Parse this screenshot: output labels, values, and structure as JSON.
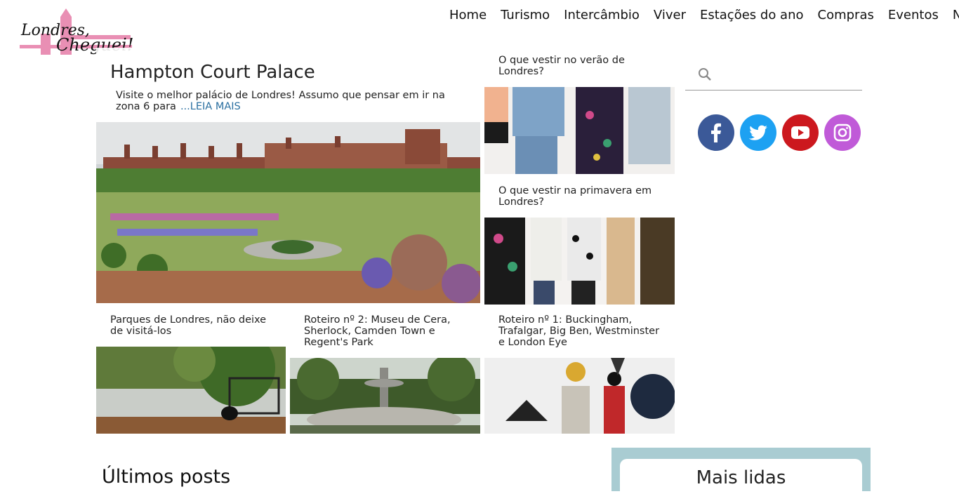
{
  "brand": {
    "logo_line1": "Londres,",
    "logo_line2": "Cheguei!"
  },
  "nav": [
    "Home",
    "Turismo",
    "Intercâmbio",
    "Viver",
    "Estações do ano",
    "Compras",
    "Eventos",
    "News"
  ],
  "hero": {
    "title": "Hampton Court Palace",
    "excerpt": "Visite o melhor palácio de Londres! Assumo que pensar em ir na zona 6 para",
    "read_more": "...LEIA MAIS"
  },
  "cards": [
    {
      "caption": "O que vestir no verão de Londres?"
    },
    {
      "caption": "O que vestir na primavera em Londres?"
    },
    {
      "caption": "Parques de Londres, não deixe de visitá-los"
    },
    {
      "caption": "Roteiro nº 2: Museu de Cera, Sherlock, Camden Town e Regent's Park"
    },
    {
      "caption": "Roteiro nº 1: Buckingham, Trafalgar, Big Ben, Westminster e London Eye"
    }
  ],
  "sidebar": {
    "search_placeholder": "",
    "social": [
      "facebook-icon",
      "twitter-icon",
      "youtube-icon",
      "instagram-icon"
    ],
    "mais_lidas": "Mais lidas"
  },
  "sections": {
    "ultimos": "Últimos posts"
  },
  "colors": {
    "facebook": "#3b5998",
    "twitter": "#1da1f2",
    "youtube": "#cc181e",
    "instagram": "#c05ad8",
    "link": "#2a6fa0",
    "logo_pink": "#e04a8a",
    "sidebar_box": "#a9ccd2"
  }
}
